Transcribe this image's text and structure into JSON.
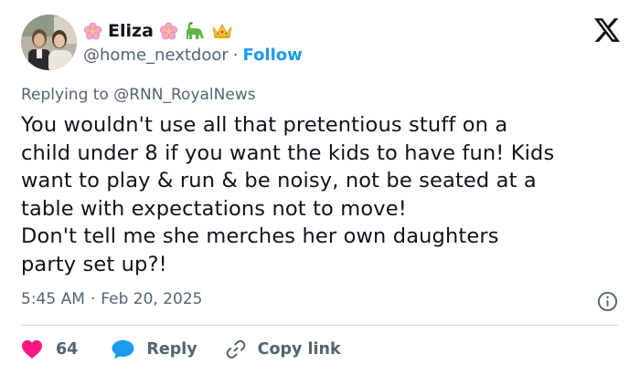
{
  "author": {
    "display_name": "Eliza",
    "handle": "@home_nextdoor",
    "separator": "·",
    "follow_label": "Follow",
    "name_emojis": [
      "cherry-blossom",
      "cherry-blossom",
      "sauropod",
      "crown"
    ]
  },
  "reply": {
    "prefix": "Replying to",
    "mention": "@RNN_RoyalNews"
  },
  "tweet": {
    "text": "You wouldn't use all that pretentious stuff on a\nchild under 8 if you want the kids to have fun! Kids\nwant to play & run & be noisy, not be seated at a\ntable with expectations not to move!\nDon't tell me she merches her own daughters\nparty set up?!",
    "time": "5:45 AM",
    "separator": "·",
    "date": "Feb 20, 2025"
  },
  "actions": {
    "likes_count": "64",
    "reply_label": "Reply",
    "copy_link_label": "Copy link"
  },
  "colors": {
    "text": "#0f1419",
    "muted": "#536471",
    "link": "#1d9bf0",
    "like": "#f91880",
    "divider": "#cfd9de"
  }
}
